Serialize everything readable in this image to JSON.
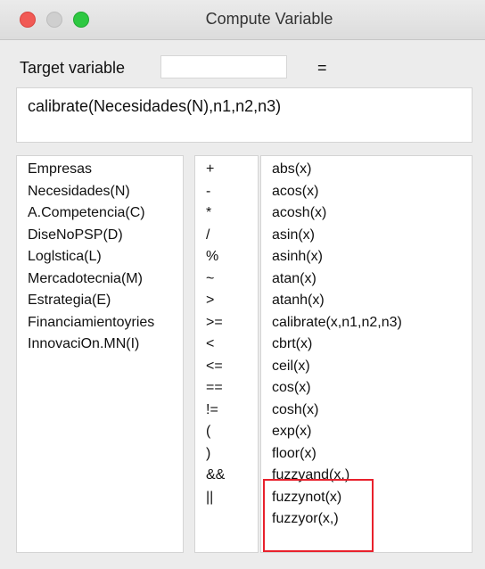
{
  "window": {
    "title": "Compute Variable"
  },
  "target": {
    "label": "Target variable",
    "value": "",
    "equals": "="
  },
  "expression": "calibrate(Necesidades(N),n1,n2,n3)",
  "variables": [
    "Empresas",
    "Necesidades(N)",
    "A.Competencia(C)",
    "DiseNoPSP(D)",
    "Loglstica(L)",
    "Mercadotecnia(M)",
    "Estrategia(E)",
    "Financiamientoyries",
    "InnovaciOn.MN(I)"
  ],
  "operators": [
    "+",
    "-",
    "*",
    "/",
    "%",
    "~",
    ">",
    ">=",
    "<",
    "<=",
    "==",
    "!=",
    "(",
    ")",
    "&&",
    "||"
  ],
  "functions": [
    "abs(x)",
    "acos(x)",
    "acosh(x)",
    "asin(x)",
    "asinh(x)",
    "atan(x)",
    "atanh(x)",
    "calibrate(x,n1,n2,n3)",
    "cbrt(x)",
    "ceil(x)",
    "cos(x)",
    "cosh(x)",
    "exp(x)",
    "floor(x)",
    "fuzzyand(x,)",
    "fuzzynot(x)",
    "fuzzyor(x,)"
  ],
  "colors": {
    "highlight": "#e8212c"
  }
}
